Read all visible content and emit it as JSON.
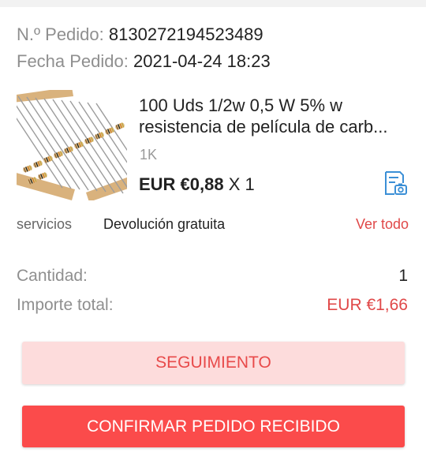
{
  "order": {
    "number_label": "N.º Pedido:",
    "number_value": "8130272194523489",
    "date_label": "Fecha Pedido:",
    "date_value": "2021-04-24 18:23"
  },
  "product": {
    "image_icon": "resistor-strip-image",
    "title_line1": "100 Uds 1/2w 0,5 W 5% w",
    "title_line2": "resistencia de película de carb...",
    "variant": "1K",
    "price": "EUR €0,88",
    "quantity_text": "X 1",
    "receipt_icon": "receipt-photo-icon"
  },
  "services": {
    "label": "servicios",
    "value": "Devolución gratuita",
    "link": "Ver todo"
  },
  "summary": {
    "qty_label": "Cantidad:",
    "qty_value": "1",
    "total_label": "Importe total:",
    "total_value": "EUR €1,66"
  },
  "actions": {
    "track_label": "SEGUIMIENTO",
    "confirm_label": "CONFIRMAR PEDIDO RECIBIDO"
  },
  "colors": {
    "accent_red": "#e04848",
    "button_red": "#fb4b4b",
    "button_pink": "#fddcdc",
    "icon_blue": "#3b8fd6"
  }
}
